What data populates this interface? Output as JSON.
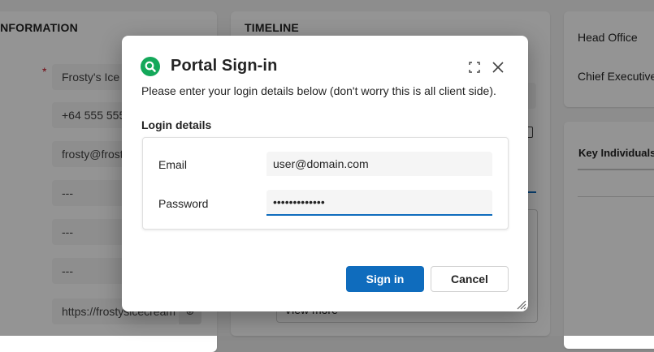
{
  "background": {
    "information_title": "INFORMATION",
    "information_fields": [
      "Frosty's Ice Cream",
      "+64 555 555",
      "frosty@frostysicecream",
      "---",
      "---",
      "---",
      "https://frostysicecream"
    ],
    "timeline_title": "TIMELINE",
    "view_more": "View more",
    "office_lines": [
      "Head Office",
      "Chief Executive"
    ],
    "key_individuals_title": "Key Individuals"
  },
  "dialog": {
    "title": "Portal Sign-in",
    "description": "Please enter your login details below (don't worry this is all client side).",
    "section_label": "Login details",
    "email_label": "Email",
    "email_value": "user@domain.com",
    "password_label": "Password",
    "password_value": "passwordvalue",
    "sign_in_label": "Sign in",
    "cancel_label": "Cancel",
    "icons": {
      "app": "search-icon",
      "maximize": "maximize-icon",
      "close": "close-icon",
      "resize": "resize-grip-icon"
    },
    "colors": {
      "accent": "#0f6cbd",
      "app_icon": "#14a85a"
    }
  }
}
